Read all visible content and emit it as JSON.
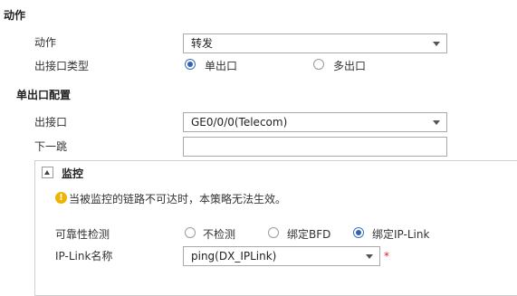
{
  "action_section": {
    "title": "动作",
    "action_label": "动作",
    "action_value": "转发",
    "outif_type_label": "出接口类型",
    "outif_type_options": [
      "单出口",
      "多出口"
    ],
    "outif_type_selected": "单出口"
  },
  "single_outif_section": {
    "title": "单出口配置",
    "outif_label": "出接口",
    "outif_value": "GE0/0/0(Telecom)",
    "nexthop_label": "下一跳",
    "nexthop_value": ""
  },
  "monitor_section": {
    "title": "监控",
    "warning_text": "当被监控的链路不可达时，本策略无法生效。",
    "reliability_label": "可靠性检测",
    "reliability_options": [
      "不检测",
      "绑定BFD",
      "绑定IP-Link"
    ],
    "reliability_selected": "绑定IP-Link",
    "iplink_label": "IP-Link名称",
    "iplink_value": "ping(DX_IPLink)",
    "required_mark": "*"
  },
  "colors": {
    "accent": "#2f63b8",
    "warning": "#f0b400",
    "required": "#e02020",
    "border": "#a9a9a9"
  }
}
